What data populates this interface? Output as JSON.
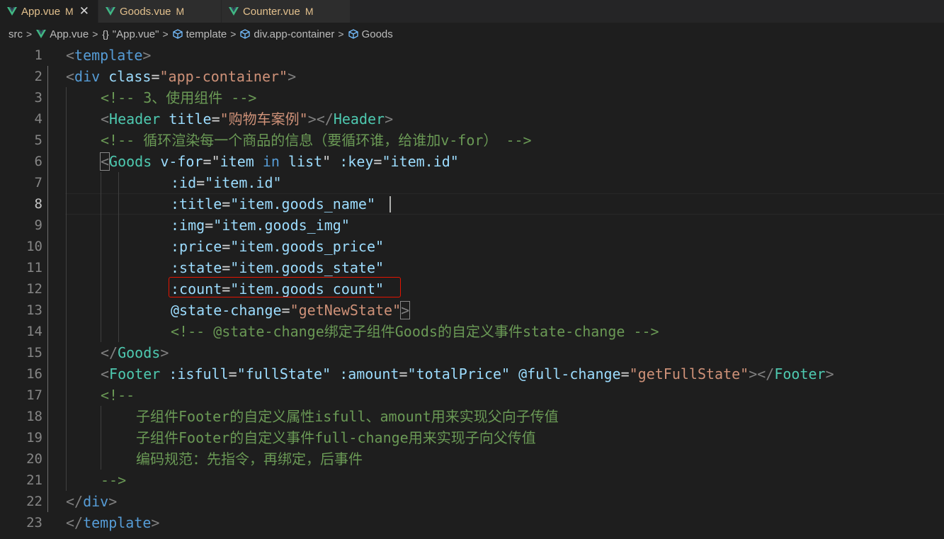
{
  "tabs": [
    {
      "name": "App.vue",
      "modified": "M",
      "close": "✕",
      "active": true
    },
    {
      "name": "Goods.vue",
      "modified": "M",
      "active": false
    },
    {
      "name": "Counter.vue",
      "modified": "M",
      "active": false
    }
  ],
  "breadcrumbs": {
    "src": "src",
    "file": "App.vue",
    "braces": "{}",
    "script": "\"App.vue\"",
    "template": "template",
    "container": "div.app-container",
    "goods": "Goods"
  },
  "editor": {
    "current_line": "8",
    "line_numbers": [
      "1",
      "2",
      "3",
      "4",
      "5",
      "6",
      "7",
      "8",
      "9",
      "10",
      "11",
      "12",
      "13",
      "14",
      "15",
      "16",
      "17",
      "18",
      "19",
      "20",
      "21",
      "22",
      "23"
    ],
    "lines": {
      "l1": {
        "lt": "<",
        "tag": "template",
        "gt": ">"
      },
      "l2": {
        "lt": "<",
        "tag": "div",
        "attr": "class",
        "eq": "=",
        "val": "\"app-container\"",
        "gt": ">"
      },
      "l3": {
        "comment": "<!-- 3、使用组件 -->"
      },
      "l4": {
        "lt": "<",
        "comp": "Header",
        "attr": "title",
        "eq": "=",
        "val": "\"购物车案例\"",
        "mid": "></",
        "comp2": "Header",
        "gt": ">"
      },
      "l5": {
        "comment": "<!-- 循环渲染每一个商品的信息（要循环谁，给谁加v-for） -->"
      },
      "l6": {
        "lt": "<",
        "comp": "Goods",
        "attr1": "v-for",
        "eq1": "=",
        "q1": "\"",
        "v1a": "item",
        "kw": "in",
        "v1b": "list",
        "q2": "\"",
        "attr2": ":key",
        "eq2": "=",
        "val2": "\"item.id\""
      },
      "l7": {
        "attr": ":id",
        "eq": "=",
        "val": "\"item.id\""
      },
      "l8": {
        "attr": ":title",
        "eq": "=",
        "val": "\"item.goods_name\""
      },
      "l9": {
        "attr": ":img",
        "eq": "=",
        "val": "\"item.goods_img\""
      },
      "l10": {
        "attr": ":price",
        "eq": "=",
        "val": "\"item.goods_price\""
      },
      "l11": {
        "attr": ":state",
        "eq": "=",
        "val": "\"item.goods_state\""
      },
      "l12": {
        "attr": ":count",
        "eq": "=",
        "val": "\"item.goods_count\""
      },
      "l13": {
        "attr": "@state-change",
        "eq": "=",
        "val": "\"getNewState\"",
        "gt": ">"
      },
      "l14": {
        "comment": "<!-- @state-change绑定子组件Goods的自定义事件state-change -->"
      },
      "l15": {
        "lt": "</",
        "comp": "Goods",
        "gt": ">"
      },
      "l16": {
        "lt": "<",
        "comp": "Footer",
        "a1": ":isfull",
        "e1": "=",
        "v1": "\"fullState\"",
        "a2": ":amount",
        "e2": "=",
        "v2": "\"totalPrice\"",
        "a3": "@full-change",
        "e3": "=",
        "v3": "\"getFullState\"",
        "mid": "></",
        "comp2": "Footer",
        "gt": ">"
      },
      "l17": {
        "comment": "<!--"
      },
      "l18": {
        "comment": "子组件Footer的自定义属性isfull、amount用来实现父向子传值"
      },
      "l19": {
        "comment": "子组件Footer的自定义事件full-change用来实现子向父传值"
      },
      "l20": {
        "comment": "编码规范：先指令，再绑定，后事件"
      },
      "l21": {
        "comment": "-->"
      },
      "l22": {
        "lt": "</",
        "tag": "div",
        "gt": ">"
      },
      "l23": {
        "lt": "</",
        "tag": "template",
        "gt": ">"
      }
    }
  },
  "colors": {
    "background": "#1e1e1e",
    "tag": "#569cd6",
    "component": "#4ec9b0",
    "attribute": "#9cdcfe",
    "string": "#ce9178",
    "comment": "#6a9955",
    "highlight_box": "#e51400",
    "vue_logo": "#41b883"
  }
}
